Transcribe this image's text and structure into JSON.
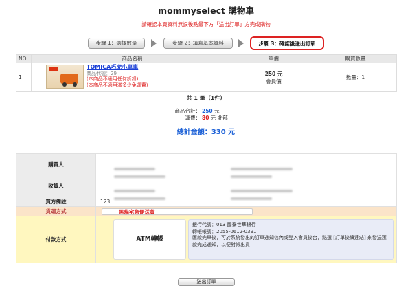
{
  "page": {
    "title": "mommyselect 購物車",
    "notice": "請確認本頁資料無誤後點最下方「送出訂單」方完成購物"
  },
  "steps": [
    {
      "label": "步驟 1：選擇數量"
    },
    {
      "label": "步驟 2：填寫基本資料"
    },
    {
      "label": "步驟 3：確認後送出訂單"
    }
  ],
  "cart": {
    "headers": {
      "no": "NO",
      "name": "商品名稱",
      "price": "單價",
      "qty": "購買數量"
    },
    "items": [
      {
        "no": "1",
        "name": "TOMICA巧虎小車車",
        "code": "商品代號：29",
        "warn1": "(本商品不適用任何折扣)",
        "warn2": "(本商品不適用滿多少免運費)",
        "price": "250 元",
        "price_note": "會員價",
        "qty": "數量：1"
      }
    ]
  },
  "summary": {
    "count": "共 1 筆（1件）",
    "subtotal_label": "商品合計：",
    "subtotal_value": "250",
    "subtotal_unit": " 元",
    "shipping_label": "運費：",
    "shipping_value": "80",
    "shipping_unit": " 元 北部",
    "grand_total": "總計金額：330 元"
  },
  "info": {
    "buyer_label": "購買人",
    "receiver_label": "收貨人",
    "buyer_note_label": "買方備註",
    "buyer_note_value": "123",
    "shipping_method_label": "貨運方式",
    "shipping_method_value": "黑貓宅急便送貨",
    "payment_method_label": "付款方式",
    "payment_method_value": "ATM轉帳",
    "bank_code": "銀行代號：013 國泰世華銀行",
    "bank_account": "轉帳帳號：2055-0612-0391",
    "bank_note": "匯款完畢後，可於系統發出的訂單通知信內或登入會員後台，點選 [訂單後續連結] 來發送匯款完成通知，以便對帳出貨"
  },
  "submit_label": "送出訂單"
}
